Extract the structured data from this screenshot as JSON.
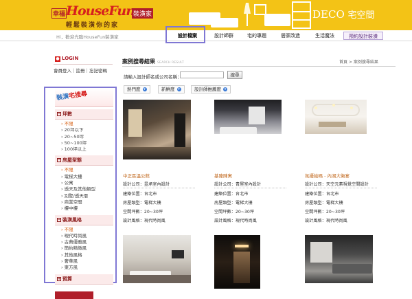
{
  "banner": {
    "logo_prefix": "幸福",
    "logo_main": "HouseFun",
    "logo_suffix": "裝潢家",
    "slogan": "輕鬆裝潢你的家",
    "deco_latin": "DECO",
    "deco_cn": "宅空間",
    "background_color": "#f3c316"
  },
  "nav": {
    "welcome": "Hi，歡迎光臨HouseFun裝潢家",
    "items": [
      "設計檔案",
      "設計師群",
      "宅的專題",
      "居家改造",
      "生活魔法",
      "預約設計裝潢"
    ],
    "active_index": 0
  },
  "login": {
    "title": "LOGIN",
    "links": "會員登入｜註冊｜忘記密碼"
  },
  "sidebar": {
    "title_a": "裝潢",
    "title_b": "宅搜尋",
    "categories": [
      {
        "label": "坪數",
        "items": [
          "不限",
          "20坪以下",
          "20~50坪",
          "50~100坪",
          "100坪以上"
        ],
        "selected": 0
      },
      {
        "label": "房屋型態",
        "items": [
          "不限",
          "電梯大樓",
          "公寓",
          "透天及其他類型",
          "別墅/透天厝",
          "商業空間",
          "樓中樓"
        ],
        "selected": 0
      },
      {
        "label": "裝潢風格",
        "items": [
          "不限",
          "現代時尚風",
          "古典優雅風",
          "簡約精緻風",
          "其他風格",
          "奢華風",
          "東方風"
        ],
        "selected": 0
      },
      {
        "label": "預算",
        "items": [],
        "selected": -1
      }
    ]
  },
  "main": {
    "title": "案例搜尋結果",
    "title_en": "SEARCH RESULT",
    "breadcrumb": "首頁 > 案例搜尋結果",
    "search_label": "請輸入設計師名或公司名稱：",
    "search_value": "",
    "search_button": "搜尋",
    "sort_buttons": [
      "熱門度",
      "新鮮度",
      "設計師推薦度"
    ]
  },
  "cases": [
    {
      "title": "中正區溫公館",
      "designer": "設計公司：昱承室內設計",
      "location": "建築位置：台北市",
      "type": "房屋類型：電梯大樓",
      "area": "空間坪數：20~30坪",
      "style": "設計風格：現代時尚風"
    },
    {
      "title": "基隆陳寓",
      "designer": "設計公司：青屋室內設計",
      "location": "建築位置：台北市",
      "type": "房屋類型：電梯大樓",
      "area": "空間坪數：20~30坪",
      "style": "設計風格：現代時尚風"
    },
    {
      "title": "氛擾絵碼 - 內湖大衛宴",
      "designer": "設計公司：天空元素視覺空間設計",
      "location": "建築位置：台北市",
      "type": "房屋類型：電梯大樓",
      "area": "空間坪數：20~30坪",
      "style": "設計風格：現代時尚風"
    }
  ]
}
